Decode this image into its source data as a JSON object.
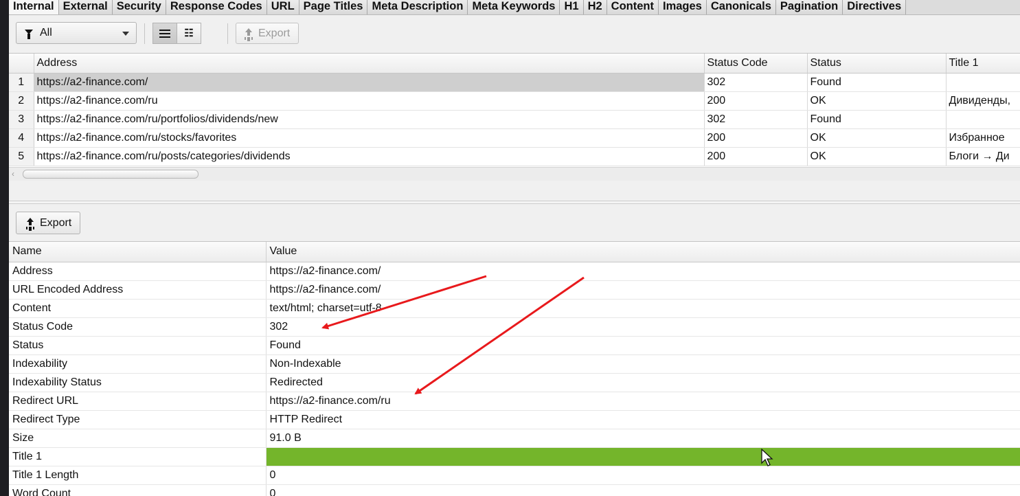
{
  "tabs": [
    "Internal",
    "External",
    "Security",
    "Response Codes",
    "URL",
    "Page Titles",
    "Meta Description",
    "Meta Keywords",
    "H1",
    "H2",
    "Content",
    "Images",
    "Canonicals",
    "Pagination",
    "Directives"
  ],
  "toolbar": {
    "filter_value": "All",
    "export_label": "Export"
  },
  "grid": {
    "columns": [
      "",
      "Address",
      "Status Code",
      "Status",
      "Title 1"
    ],
    "rows": [
      {
        "n": "1",
        "address": "https://a2-finance.com/",
        "code": "302",
        "status": "Found",
        "title": ""
      },
      {
        "n": "2",
        "address": "https://a2-finance.com/ru",
        "code": "200",
        "status": "OK",
        "title": "Дивиденды,"
      },
      {
        "n": "3",
        "address": "https://a2-finance.com/ru/portfolios/dividends/new",
        "code": "302",
        "status": "Found",
        "title": ""
      },
      {
        "n": "4",
        "address": "https://a2-finance.com/ru/stocks/favorites",
        "code": "200",
        "status": "OK",
        "title": "Избранное"
      },
      {
        "n": "5",
        "address": "https://a2-finance.com/ru/posts/categories/dividends",
        "code": "200",
        "status": "OK",
        "title": "Блоги → Ди"
      }
    ]
  },
  "details": {
    "export_label": "Export",
    "columns": [
      "Name",
      "Value"
    ],
    "rows": [
      {
        "name": "Address",
        "value": "https://a2-finance.com/"
      },
      {
        "name": "URL Encoded Address",
        "value": "https://a2-finance.com/"
      },
      {
        "name": "Content",
        "value": "text/html; charset=utf-8"
      },
      {
        "name": "Status Code",
        "value": "302"
      },
      {
        "name": "Status",
        "value": "Found"
      },
      {
        "name": "Indexability",
        "value": "Non-Indexable"
      },
      {
        "name": "Indexability Status",
        "value": "Redirected"
      },
      {
        "name": "Redirect URL",
        "value": "https://a2-finance.com/ru"
      },
      {
        "name": "Redirect Type",
        "value": "HTTP Redirect"
      },
      {
        "name": "Size",
        "value": "91.0 B"
      },
      {
        "name": "Title 1",
        "value": ""
      },
      {
        "name": "Title 1 Length",
        "value": "0"
      },
      {
        "name": "Word Count",
        "value": "0"
      }
    ]
  },
  "colors": {
    "highlight_green": "#74b52b",
    "annotation_red": "#e8191c"
  }
}
